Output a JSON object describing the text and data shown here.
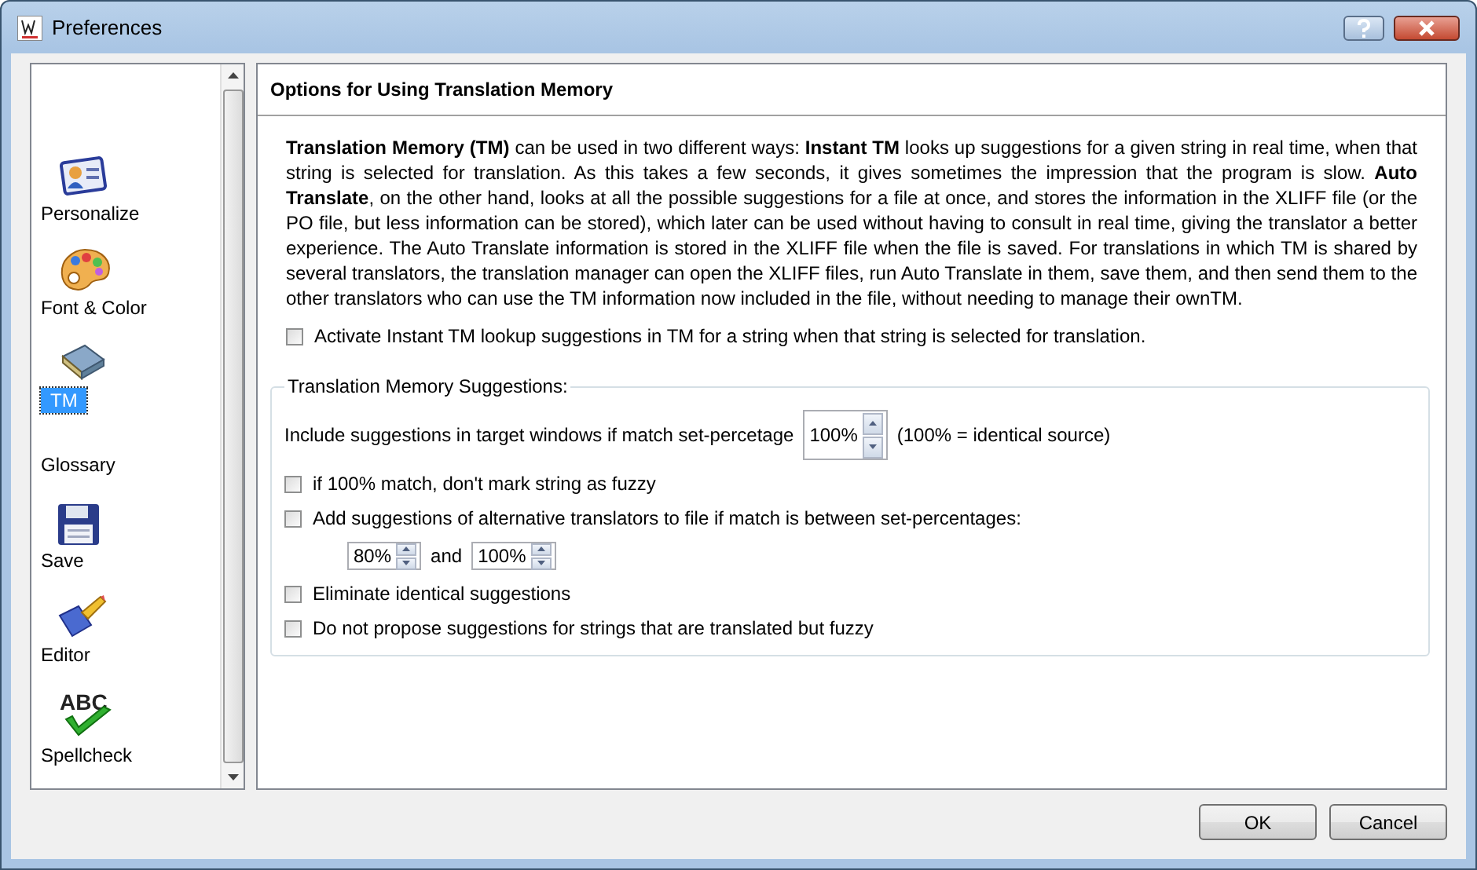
{
  "window": {
    "title": "Preferences"
  },
  "sidebar": {
    "items": [
      {
        "label": "Personalize",
        "selected": false
      },
      {
        "label": "Font & Color",
        "selected": false
      },
      {
        "label": "TM",
        "selected": true
      },
      {
        "label": "Glossary",
        "selected": false
      },
      {
        "label": "Save",
        "selected": false
      },
      {
        "label": "Editor",
        "selected": false
      },
      {
        "label": "Spellcheck",
        "selected": false,
        "icon_text": "ABC"
      }
    ]
  },
  "panel": {
    "title": "Options for Using Translation Memory",
    "description": "**Translation Memory (TM)** can be used in two different ways: **Instant TM** looks up suggestions for a given string in real time, when that string is selected for translation. As this takes a few seconds, it gives sometimes the impression that the program is slow. **Auto Translate**, on the other hand, looks at all the possible suggestions for a file at once, and stores the information in the XLIFF file (or the PO file, but less information can be stored), which later can be used without having to consult in real time, giving the translator a better experience. The Auto Translate information is stored in the XLIFF file when the file is saved. For translations in which TM is shared by several translators, the translation manager can open the XLIFF files, run Auto Translate in them, save them, and then send them to the other translators who can use the TM information now included in the file, without needing to manage their ownTM.",
    "instant_tm": {
      "label": "Activate Instant TM lookup suggestions in TM for a string when that string is selected for translation.",
      "checked": false
    },
    "group": {
      "title": "Translation Memory Suggestions:",
      "rows": [
        {
          "kind": "spin",
          "label": "Include suggestions in target windows if match set-percetage",
          "value": "100%",
          "note": "(100% = identical source)"
        },
        {
          "kind": "check",
          "label": "if 100% match, don't mark string as fuzzy",
          "checked": false
        },
        {
          "kind": "check",
          "label": "Add suggestions of alternative translators to file if match is between set-percentages:",
          "checked": false
        },
        {
          "kind": "range",
          "from": "80%",
          "joiner": "and",
          "to": "100%"
        },
        {
          "kind": "check",
          "label": "Eliminate identical suggestions",
          "checked": false
        },
        {
          "kind": "check",
          "label": "Do not propose suggestions for strings that are translated but fuzzy",
          "checked": false
        }
      ]
    }
  },
  "buttons": [
    "OK",
    "Cancel"
  ]
}
